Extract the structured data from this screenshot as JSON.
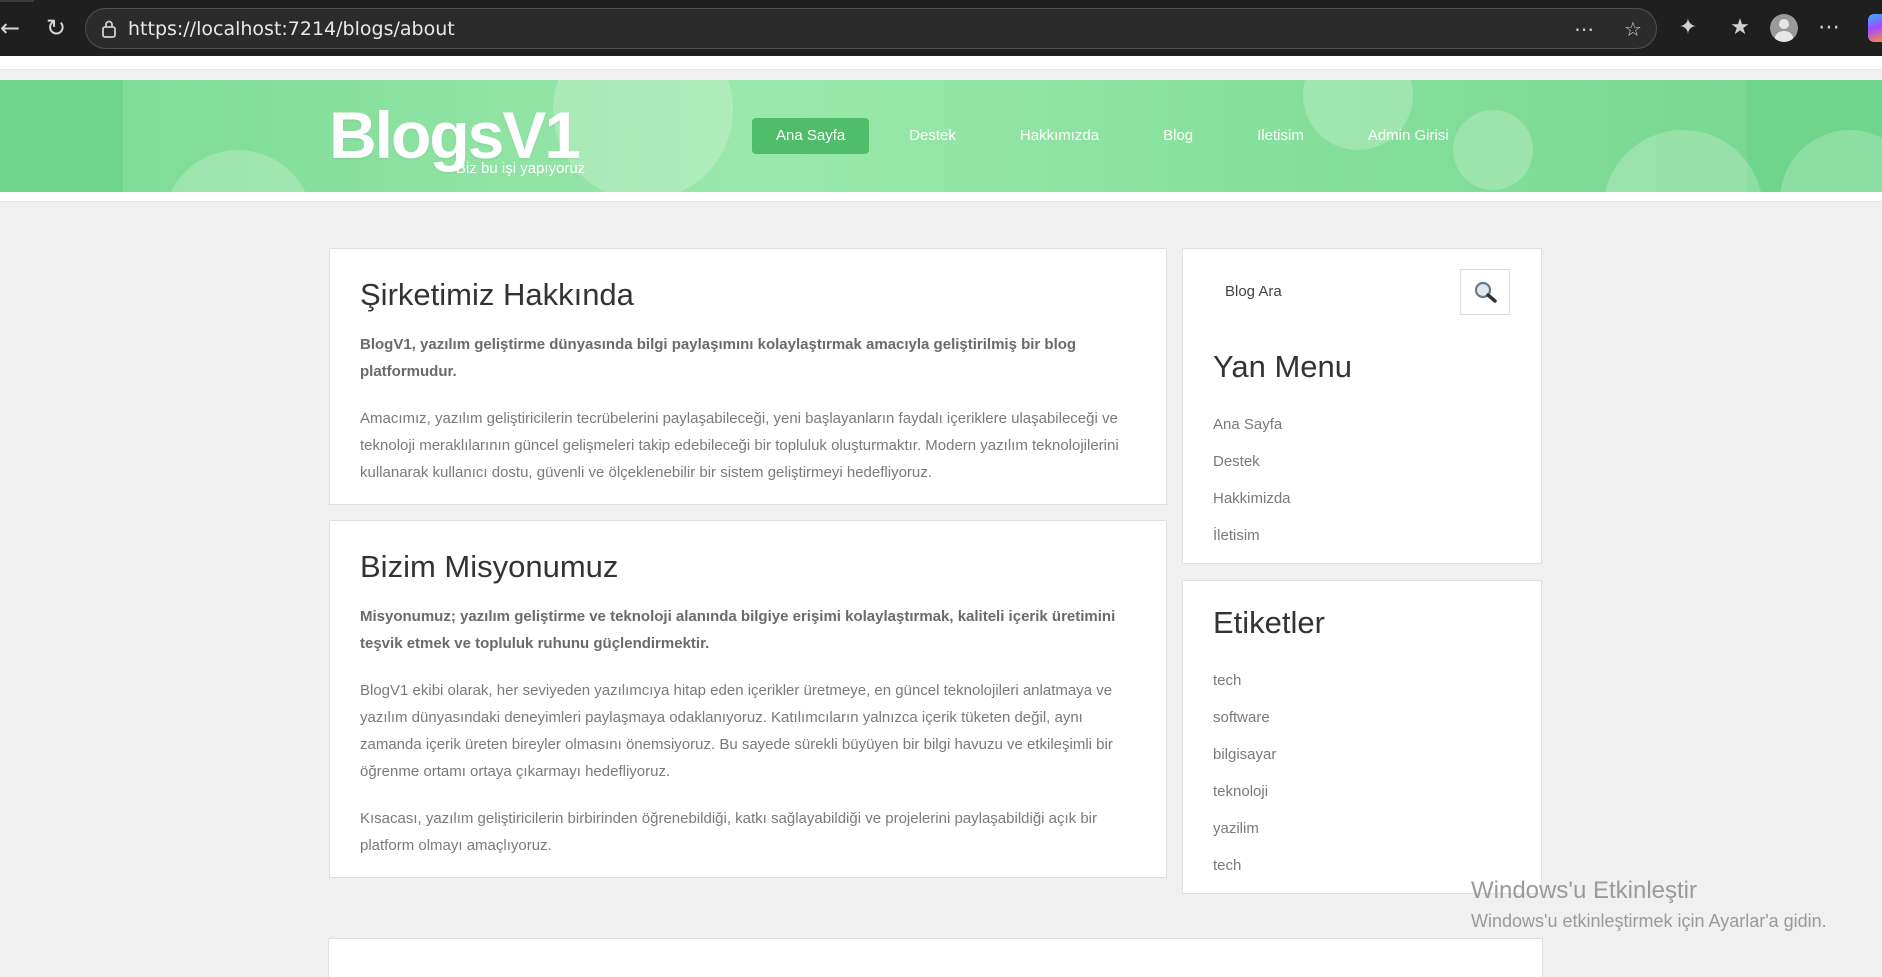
{
  "browser": {
    "url": "https://localhost:7214/blogs/about",
    "icons": {
      "back": "back-arrow-icon",
      "reload": "reload-icon",
      "lock": "lock-icon",
      "reader": "reader-mode-icon",
      "favorite": "star-icon",
      "extensions": "puzzle-icon",
      "favorites": "favorites-icon",
      "profile": "avatar-icon",
      "more": "more-icon"
    }
  },
  "header": {
    "logo": "BlogsV1",
    "tagline": "Biz bu işi yapıyoruz",
    "nav": [
      {
        "label": "Ana Sayfa",
        "active": true
      },
      {
        "label": "Destek",
        "active": false
      },
      {
        "label": "Hakkımızda",
        "active": false
      },
      {
        "label": "Blog",
        "active": false
      },
      {
        "label": "Iletisim",
        "active": false
      },
      {
        "label": "Admin Girisi",
        "active": false
      }
    ],
    "colors": {
      "banner": "#6ed58a",
      "active_nav": "#4fbd69"
    }
  },
  "about": {
    "title": "Şirketimiz Hakkında",
    "lead": "BlogV1, yazılım geliştirme dünyasında bilgi paylaşımını kolaylaştırmak amacıyla geliştirilmiş bir blog platformudur.",
    "body": "Amacımız, yazılım geliştiricilerin tecrübelerini paylaşabileceği, yeni başlayanların faydalı içeriklere ulaşabileceği ve teknoloji meraklılarının güncel gelişmeleri takip edebileceği bir topluluk oluşturmaktır. Modern yazılım teknolojilerini kullanarak kullanıcı dostu, güvenli ve ölçeklenebilir bir sistem geliştirmeyi hedefliyoruz."
  },
  "mission": {
    "title": "Bizim Misyonumuz",
    "lead": "Misyonumuz; yazılım geliştirme ve teknoloji alanında bilgiye erişimi kolaylaştırmak, kaliteli içerik üretimini teşvik etmek ve topluluk ruhunu güçlendirmektir.",
    "body1": "BlogV1 ekibi olarak, her seviyeden yazılımcıya hitap eden içerikler üretmeye, en güncel teknolojileri anlatmaya ve yazılım dünyasındaki deneyimleri paylaşmaya odaklanıyoruz. Katılımcıların yalnızca içerik tüketen değil, aynı zamanda içerik üreten bireyler olmasını önemsiyoruz. Bu sayede sürekli büyüyen bir bilgi havuzu ve etkileşimli bir öğrenme ortamı ortaya çıkarmayı hedefliyoruz.",
    "body2": "Kısacası, yazılım geliştiricilerin birbirinden öğrenebildiği, katkı sağlayabildiği ve projelerini paylaşabildiği açık bir platform olmayı amaçlıyoruz."
  },
  "sidebar": {
    "search_placeholder": "Blog Ara",
    "search_icon": "magnifier-icon",
    "menu_title": "Yan Menu",
    "menu_items": [
      "Ana Sayfa",
      "Destek",
      "Hakkimizda",
      "İletisim"
    ],
    "tags_title": "Etiketler",
    "tags": [
      "tech",
      "software",
      "bilgisayar",
      "teknoloji",
      "yazilim",
      "tech"
    ]
  },
  "watermark": {
    "title": "Windows'u Etkinleştir",
    "subtitle": "Windows'u etkinleştirmek için Ayarlar'a gidin."
  }
}
